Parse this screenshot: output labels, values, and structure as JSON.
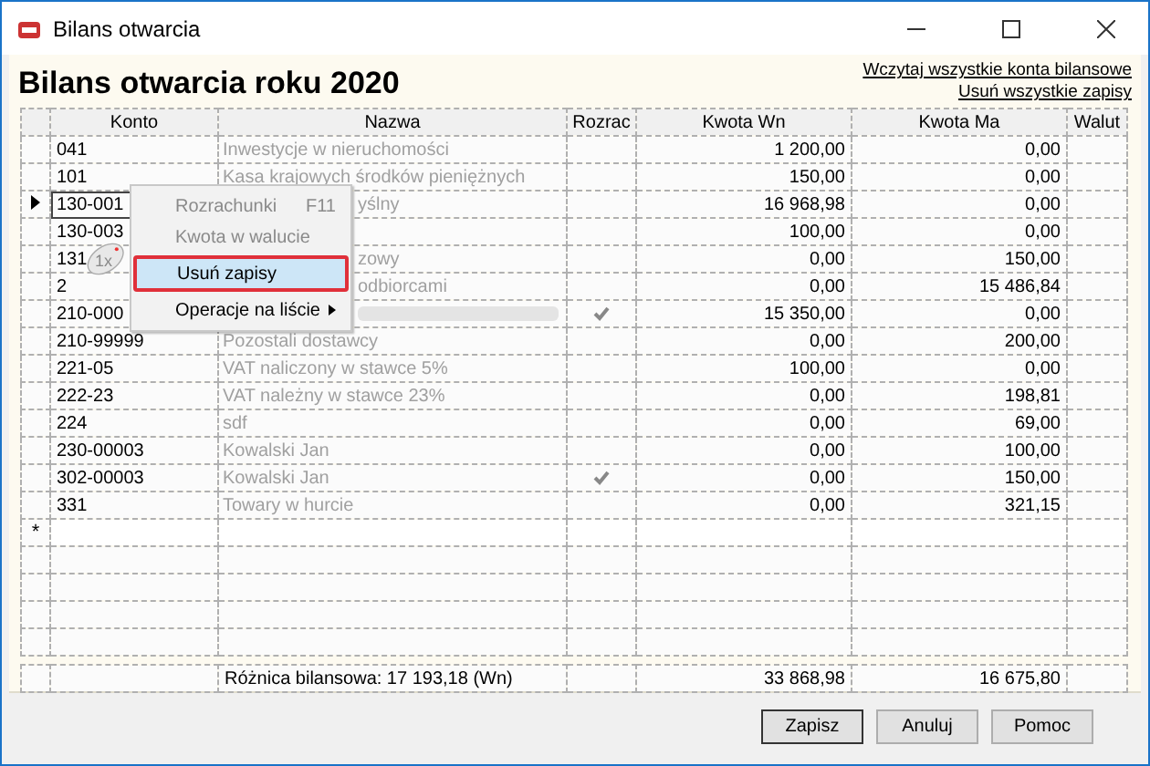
{
  "window": {
    "title": "Bilans otwarcia"
  },
  "heading": "Bilans otwarcia roku 2020",
  "links": [
    "Wczytaj wszystkie konta bilansowe",
    "Usuń wszystkie zapisy"
  ],
  "table": {
    "columns": [
      "Konto",
      "Nazwa",
      "Rozrac",
      "Kwota Wn",
      "Kwota Ma",
      "Walut"
    ],
    "rows": [
      {
        "konto": "041",
        "nazwa": "Inwestycje w nieruchomości",
        "rozrac": false,
        "wn": "1 200,00",
        "ma": "0,00",
        "selected": false
      },
      {
        "konto": "101",
        "nazwa": "Kasa krajowych środków pieniężnych",
        "rozrac": false,
        "wn": "150,00",
        "ma": "0,00",
        "selected": false
      },
      {
        "konto": "130-001",
        "nazwa": "yślny",
        "obscured": true,
        "rozrac": false,
        "wn": "16 968,98",
        "ma": "0,00",
        "selected": true
      },
      {
        "konto": "130-003",
        "nazwa": "",
        "rozrac": false,
        "wn": "100,00",
        "ma": "0,00",
        "selected": false
      },
      {
        "konto": "131",
        "nazwa": "zowy",
        "obscured": true,
        "rozrac": false,
        "wn": "0,00",
        "ma": "150,00",
        "selected": false
      },
      {
        "konto": "2",
        "nazwa": "odbiorcami",
        "obscured": true,
        "rozrac": false,
        "wn": "0,00",
        "ma": "15 486,84",
        "selected": false
      },
      {
        "konto": "210-000",
        "nazwa": "",
        "obscured": true,
        "blurred": true,
        "rozrac": true,
        "wn": "15 350,00",
        "ma": "0,00",
        "selected": false
      },
      {
        "konto": "210-99999",
        "nazwa": "Pozostali dostawcy",
        "rozrac": false,
        "wn": "0,00",
        "ma": "200,00",
        "selected": false
      },
      {
        "konto": "221-05",
        "nazwa": "VAT naliczony w stawce 5%",
        "rozrac": false,
        "wn": "100,00",
        "ma": "0,00",
        "selected": false
      },
      {
        "konto": "222-23",
        "nazwa": "VAT należny w stawce 23%",
        "rozrac": false,
        "wn": "0,00",
        "ma": "198,81",
        "selected": false
      },
      {
        "konto": "224",
        "nazwa": "sdf",
        "rozrac": false,
        "wn": "0,00",
        "ma": "69,00",
        "selected": false
      },
      {
        "konto": "230-00003",
        "nazwa": " Kowalski Jan",
        "rozrac": false,
        "wn": "0,00",
        "ma": "100,00",
        "selected": false
      },
      {
        "konto": "302-00003",
        "nazwa": " Kowalski Jan",
        "rozrac": true,
        "wn": "0,00",
        "ma": "150,00",
        "selected": false
      },
      {
        "konto": "331",
        "nazwa": "Towary w hurcie",
        "rozrac": false,
        "wn": "0,00",
        "ma": "321,15",
        "selected": false
      }
    ],
    "new_row_marker": "*",
    "empty_rows": [
      {},
      {},
      {},
      {}
    ],
    "footer": {
      "label": "Różnica bilansowa: 17 193,18 (Wn)",
      "wn": "33 868,98",
      "ma": "16 675,80"
    }
  },
  "context_menu": {
    "items": [
      {
        "label": "Rozrachunki",
        "shortcut": "F11",
        "disabled": true,
        "selected": false,
        "submenu": false
      },
      {
        "label": "Kwota w walucie",
        "disabled": true,
        "selected": false,
        "submenu": false
      },
      {
        "label": "Usuń zapisy",
        "disabled": false,
        "selected": true,
        "submenu": false
      },
      {
        "label": "Operacje na liście",
        "disabled": false,
        "selected": false,
        "submenu": true
      }
    ]
  },
  "click_hint": "1x",
  "buttons": [
    {
      "label": "Zapisz",
      "default": true
    },
    {
      "label": "Anuluj",
      "default": false
    },
    {
      "label": "Pomoc",
      "default": false
    }
  ]
}
